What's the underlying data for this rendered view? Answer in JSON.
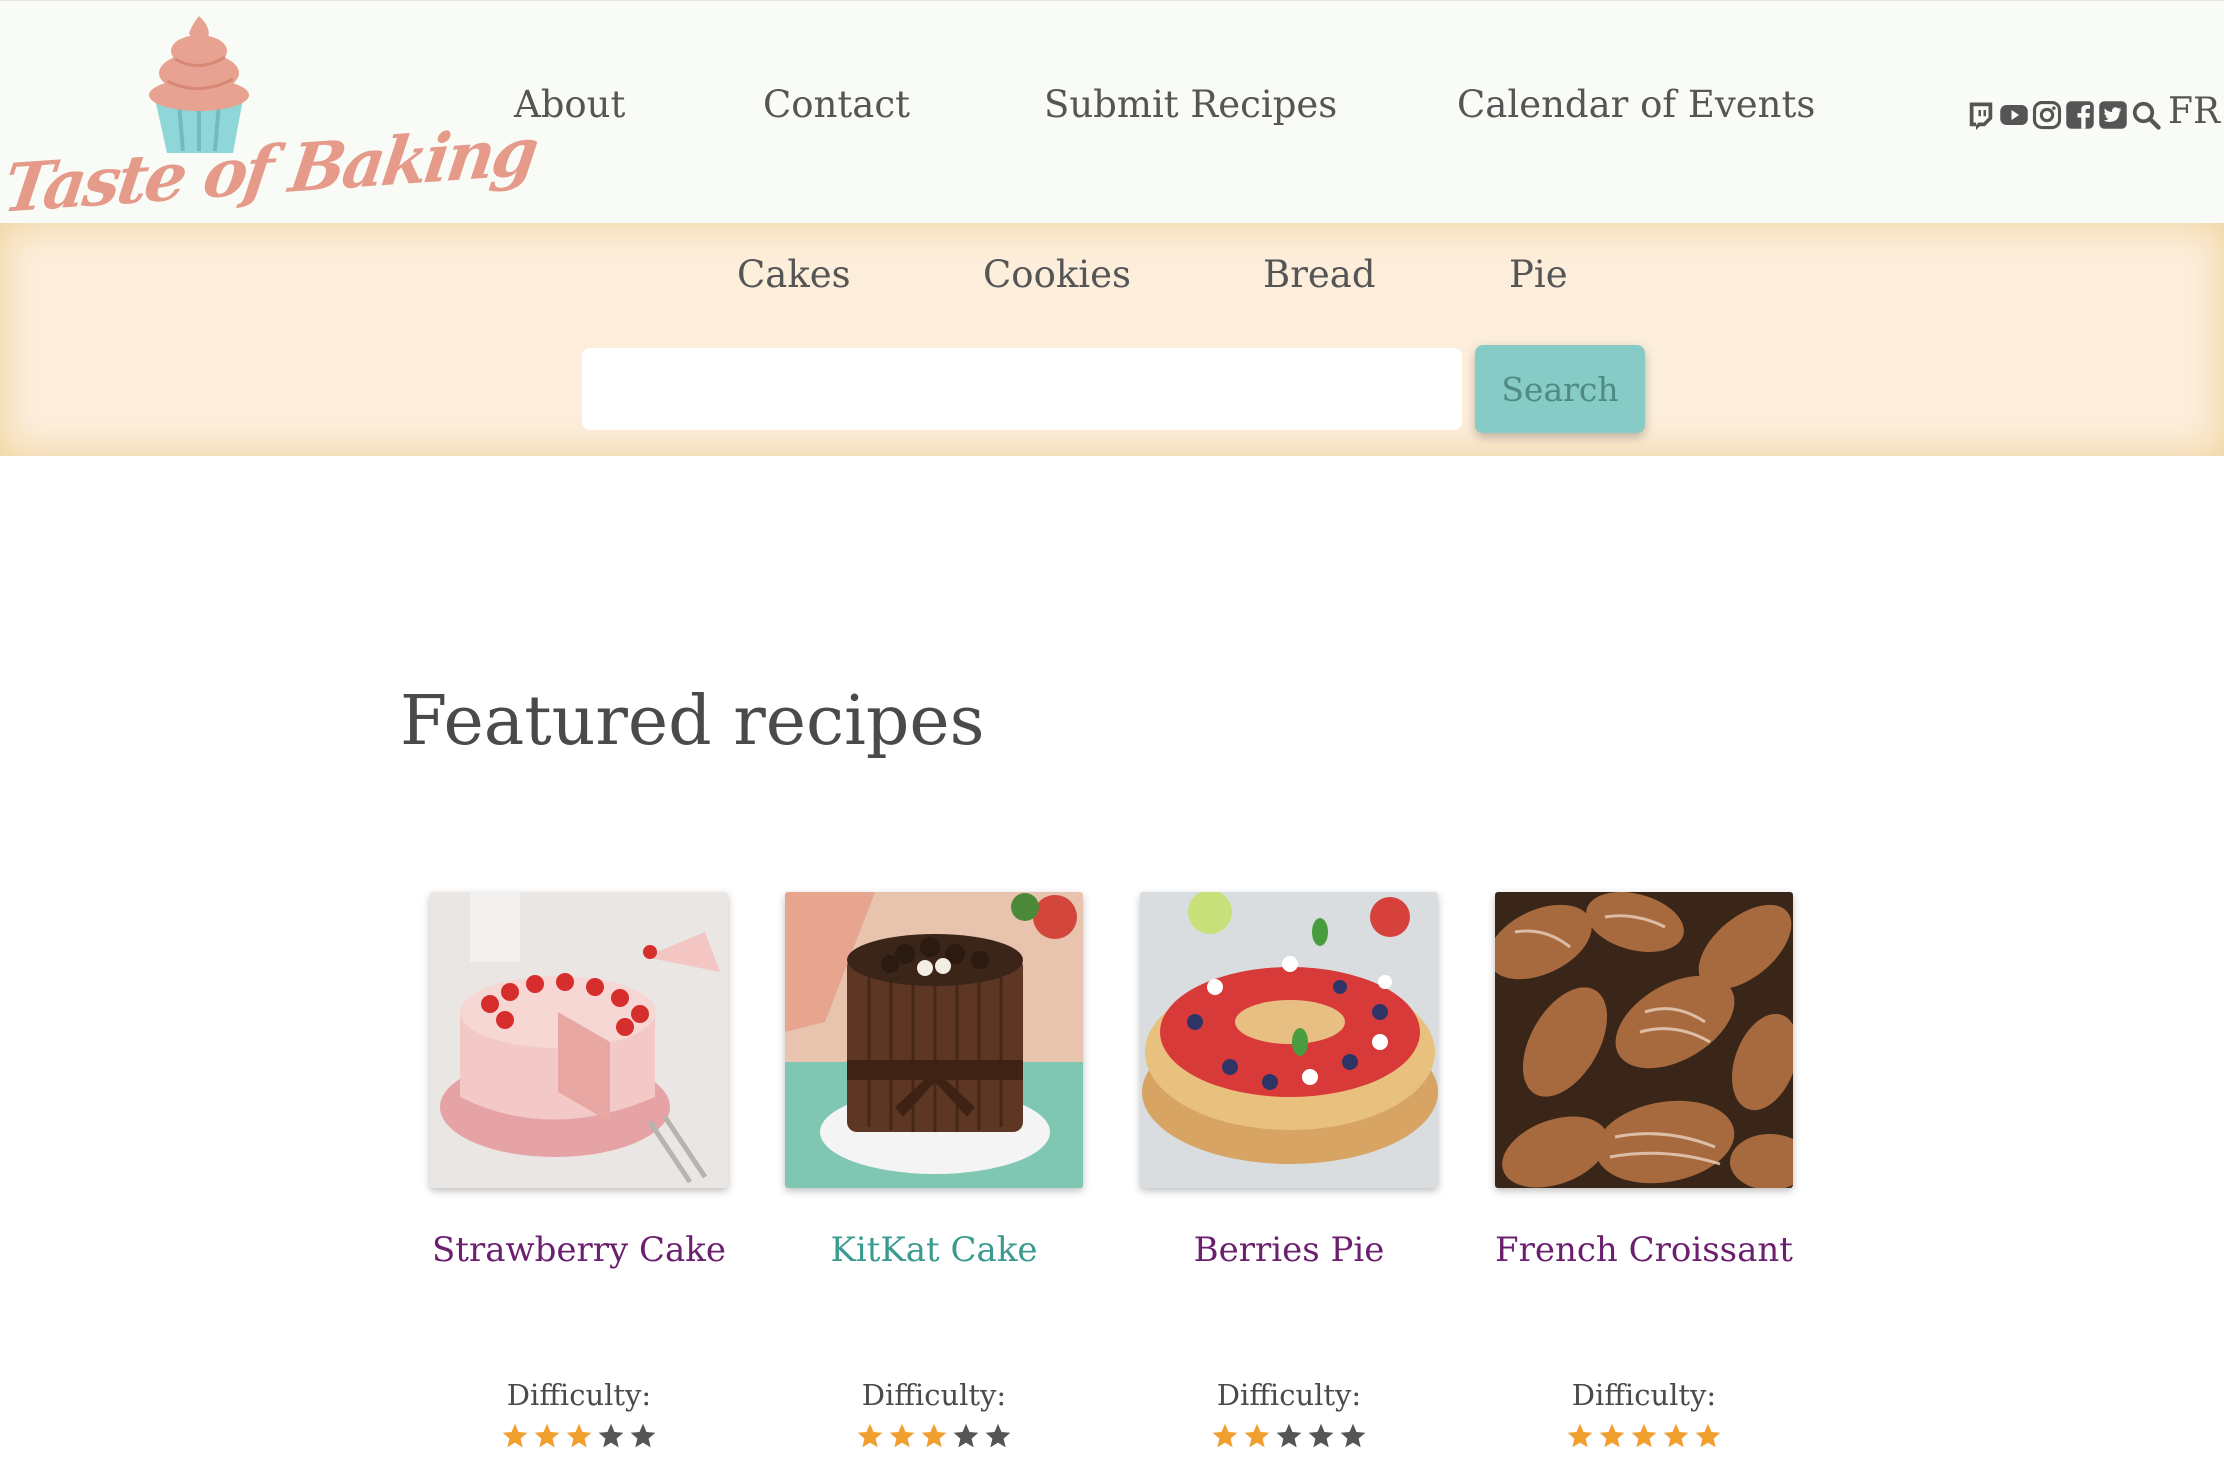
{
  "brand": {
    "name": "Taste of Baking",
    "cream_color": "#e8a291",
    "cup_color": "#8fd6d8"
  },
  "nav": [
    {
      "label": "About"
    },
    {
      "label": "Contact"
    },
    {
      "label": "Submit Recipes"
    },
    {
      "label": "Calendar of Events"
    }
  ],
  "social_icons": [
    "twitch-icon",
    "youtube-icon",
    "instagram-icon",
    "facebook-icon",
    "twitter-icon",
    "search-icon"
  ],
  "language_toggle": "FR",
  "categories": [
    {
      "label": "Cakes"
    },
    {
      "label": "Cookies"
    },
    {
      "label": "Bread"
    },
    {
      "label": "Pie"
    }
  ],
  "search": {
    "value": "",
    "placeholder": "",
    "button_label": "Search"
  },
  "featured": {
    "title": "Featured recipes",
    "recipes": [
      {
        "name": "Strawberry Cake",
        "difficulty_label": "Difficulty:",
        "difficulty": 3,
        "max": 5
      },
      {
        "name": "KitKat Cake",
        "difficulty_label": "Difficulty:",
        "difficulty": 3,
        "max": 5
      },
      {
        "name": "Berries Pie",
        "difficulty_label": "Difficulty:",
        "difficulty": 2,
        "max": 5
      },
      {
        "name": "French Croissant",
        "difficulty_label": "Difficulty:",
        "difficulty": 5,
        "max": 5
      }
    ]
  },
  "colors": {
    "header_bg": "#f9fcf6",
    "category_band": "#fdeedc",
    "search_button": "#86cbc5",
    "recipe_link": "#6b1f6e",
    "recipe_link_hover": "#3a9a8f",
    "star_filled": "#f0a030",
    "star_empty": "#555555"
  }
}
